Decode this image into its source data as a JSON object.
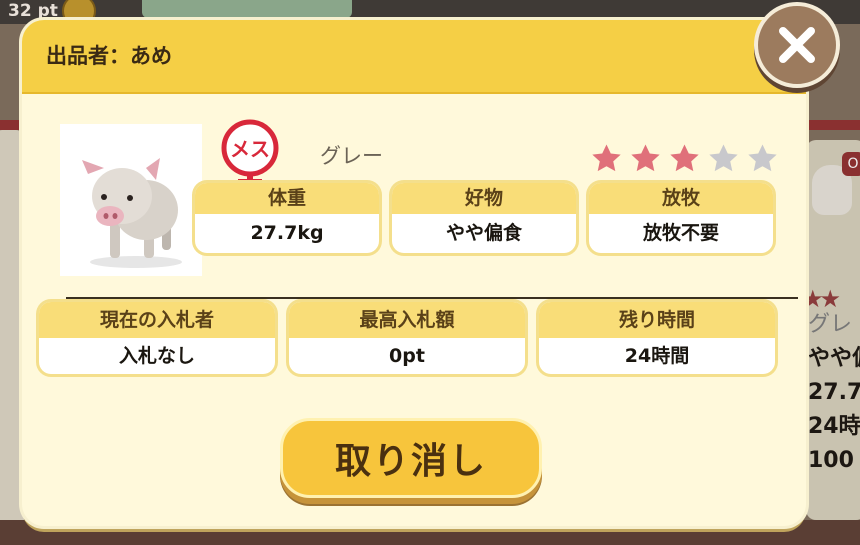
{
  "background": {
    "points_text": "32 pt",
    "right_card_badge": "O",
    "right_card_lines": [
      "グレ",
      "やや偏",
      "27.7",
      "24時",
      "100"
    ]
  },
  "dialog": {
    "seller_label": "出品者：あめ",
    "close_icon": "close-x-icon",
    "pig": {
      "gender_label": "メス",
      "color_name": "グレー",
      "rating": 3,
      "rating_max": 5,
      "star_filled_color": "#e0707a",
      "star_empty_color": "#c8c8cc"
    },
    "stats": [
      {
        "label": "体重",
        "value": "27.7kg"
      },
      {
        "label": "好物",
        "value": "やや偏食"
      },
      {
        "label": "放牧",
        "value": "放牧不要"
      }
    ],
    "auction": [
      {
        "label": "現在の入札者",
        "value": "入札なし"
      },
      {
        "label": "最高入札額",
        "value": "0pt"
      },
      {
        "label": "残り時間",
        "value": "24時間"
      }
    ],
    "cancel_label": "取り消し"
  },
  "colors": {
    "header": "#f5cf45",
    "dialog_bg": "#fff9db",
    "gender_red": "#d8283a"
  }
}
